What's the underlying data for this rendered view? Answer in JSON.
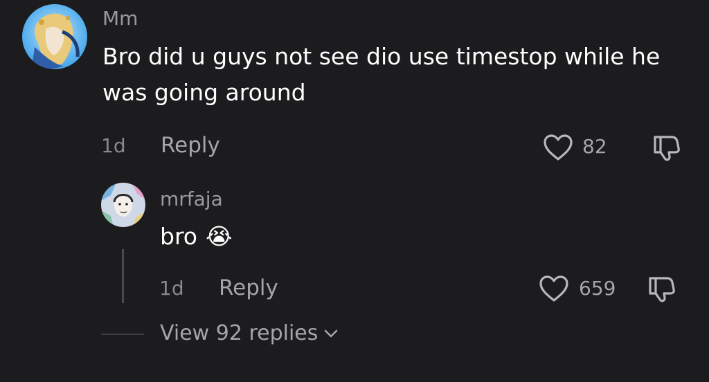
{
  "comment": {
    "username": "Mm",
    "text": "Bro did u guys not see dio use timestop while he was going around",
    "time": "1d",
    "reply_label": "Reply",
    "like_count": "82"
  },
  "reply": {
    "username": "mrfaja",
    "text": "bro",
    "emoji": "😭",
    "time": "1d",
    "reply_label": "Reply",
    "like_count": "659"
  },
  "view_replies": {
    "label": "View 92 replies"
  },
  "colors": {
    "background": "#1c1c1e",
    "primary_text": "#ffffff",
    "secondary_text": "#9a9a9e"
  },
  "icons": {
    "like": "heart-icon",
    "dislike": "thumbs-down-icon",
    "expand": "chevron-down-icon"
  }
}
